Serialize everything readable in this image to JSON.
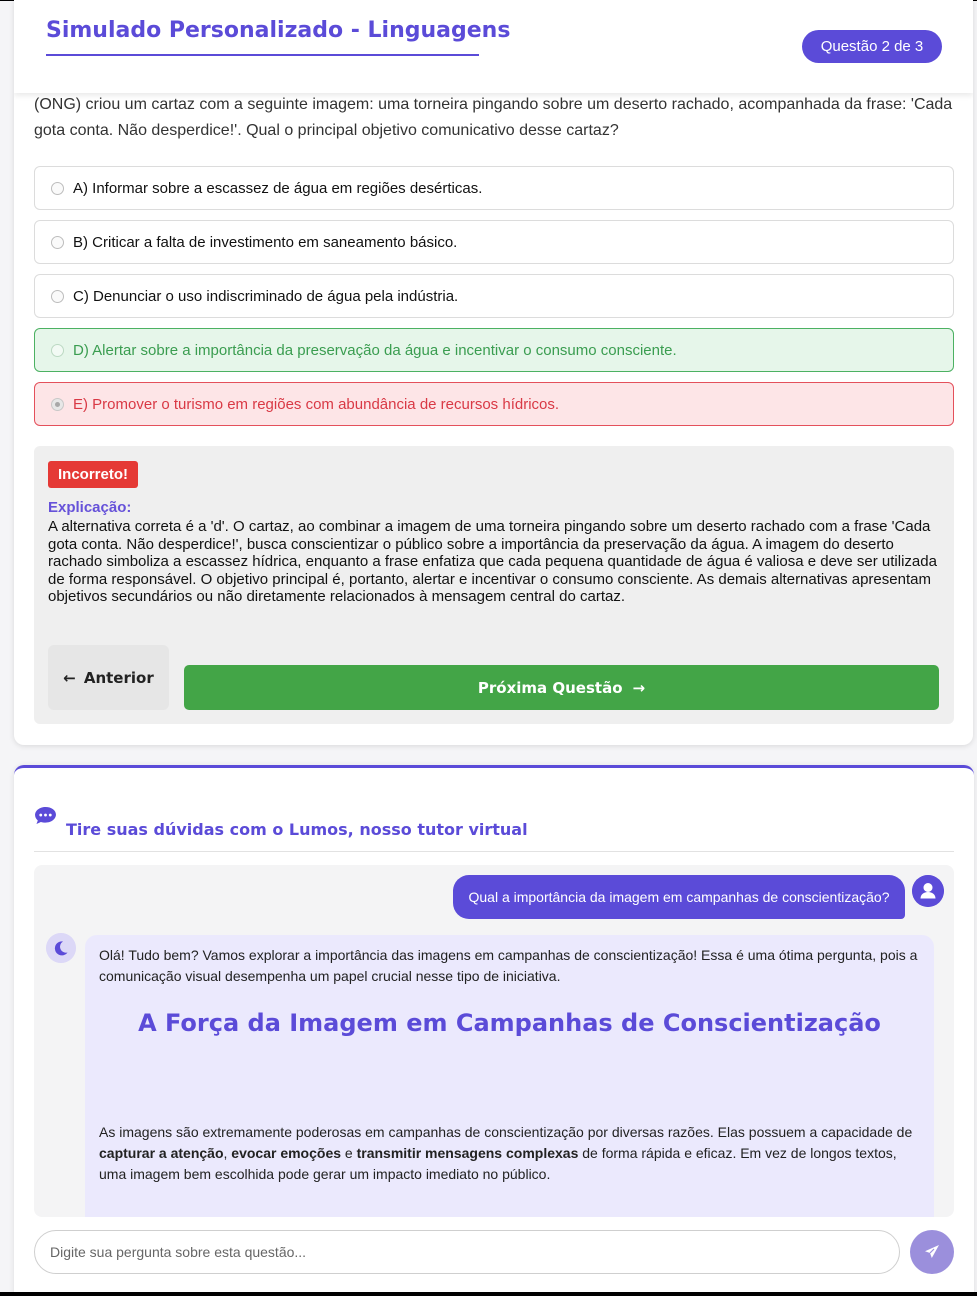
{
  "header": {
    "title": "Simulado Personalizado - Linguagens",
    "counter": "Questão 2 de 3"
  },
  "question": {
    "text_visible": "(ONG) criou um cartaz com a seguinte imagem: uma torneira pingando sobre um deserto rachado, acompanhada da frase: 'Cada gota conta. Não desperdice!'. Qual o principal objetivo comunicativo desse cartaz?",
    "options": [
      {
        "label": "A) Informar sobre a escassez de água em regiões desérticas.",
        "state": "neutral"
      },
      {
        "label": "B) Criticar a falta de investimento em saneamento básico.",
        "state": "neutral"
      },
      {
        "label": "C) Denunciar o uso indiscriminado de água pela indústria.",
        "state": "neutral"
      },
      {
        "label": "D) Alertar sobre a importância da preservação da água e incentivar o consumo consciente.",
        "state": "correct"
      },
      {
        "label": "E) Promover o turismo em regiões com abundância de recursos hídricos.",
        "state": "selected-wrong"
      }
    ]
  },
  "feedback": {
    "badge": "Incorreto!",
    "explanation_title": "Explicação:",
    "explanation_text": "A alternativa correta é a 'd'. O cartaz, ao combinar a imagem de uma torneira pingando sobre um deserto rachado com a frase 'Cada gota conta. Não desperdice!', busca conscientizar o público sobre a importância da preservação da água. A imagem do deserto rachado simboliza a escassez hídrica, enquanto a frase enfatiza que cada pequena quantidade de água é valiosa e deve ser utilizada de forma responsável. O objetivo principal é, portanto, alertar e incentivar o consumo consciente. As demais alternativas apresentam objetivos secundários ou não diretamente relacionados à mensagem central do cartaz."
  },
  "navigation": {
    "prev_label": "Anterior",
    "next_label": "Próxima Questão",
    "prev_arrow": "←",
    "next_arrow": "→"
  },
  "tutor": {
    "title": "Tire suas dúvidas com o Lumos, nosso tutor virtual",
    "user_message": "Qual a importância da imagem em campanhas de conscientização?",
    "bot_intro": "Olá! Tudo bem? Vamos explorar a importância das imagens em campanhas de conscientização! Essa é uma ótima pergunta, pois a comunicação visual desempenha um papel crucial nesse tipo de iniciativa.",
    "bot_heading": "A Força da Imagem em Campanhas de Conscientização",
    "bot_para": {
      "p1": "As imagens são extremamente poderosas em campanhas de conscientização por diversas razões. Elas possuem a capacidade de ",
      "b1": "capturar a atenção",
      "p2": ", ",
      "b2": "evocar emoções",
      "p3": " e ",
      "b3": "transmitir mensagens complexas",
      "p4": " de forma rápida e eficaz. Em vez de longos textos, uma imagem bem escolhida pode gerar um impacto imediato no público."
    },
    "input_placeholder": "Digite sua pergunta sobre esta questão..."
  },
  "colors": {
    "accent": "#5b4bd8",
    "correct": "#43a547",
    "wrong": "#e53935"
  },
  "icons": [
    "chat-bubble-icon",
    "user-icon",
    "moon-icon",
    "send-icon",
    "arrow-left-icon",
    "arrow-right-icon"
  ]
}
